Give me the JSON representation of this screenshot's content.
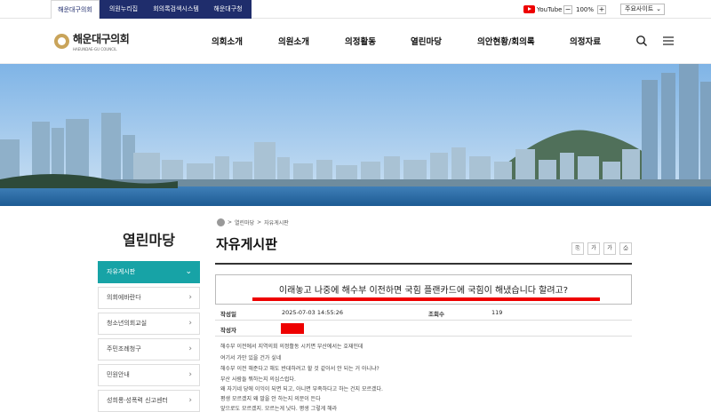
{
  "top_tabs": [
    "해운대구의회",
    "의원누리집",
    "회의록검색시스템",
    "해운대구청"
  ],
  "youtube_label": "YouTube",
  "zoom": {
    "minus": "−",
    "value": "100%",
    "plus": "+"
  },
  "sitemap_select": "주요사이트",
  "logo": {
    "main": "해운대구의회",
    "sub": "HAEUNDAE-GU COUNCIL"
  },
  "gnb": [
    "의회소개",
    "의원소개",
    "의정활동",
    "열린마당",
    "의안현황/회의록",
    "의정자료"
  ],
  "lnb": {
    "title": "열린마당",
    "items": [
      {
        "label": "자유게시판",
        "active": true,
        "arrow": "⌄"
      },
      {
        "label": "의회에바란다",
        "active": false,
        "arrow": "›"
      },
      {
        "label": "청소년의회교실",
        "active": false,
        "arrow": "›"
      },
      {
        "label": "주민조례청구",
        "active": false,
        "arrow": "›"
      },
      {
        "label": "민원안내",
        "active": false,
        "arrow": "›"
      },
      {
        "label": "성희롱·성폭력 신고센터",
        "active": false,
        "arrow": "›"
      }
    ]
  },
  "breadcrumb": {
    "sep": ">",
    "level1": "열린마당",
    "level2": "자유게시판"
  },
  "page_title": "자유게시판",
  "tools": [
    "⎘",
    "가",
    "가",
    "⎙"
  ],
  "post": {
    "title": "이래놓고 나중에 해수부 이전하면 국힘 플랜카드에 국힘이 해냈습니다 할려고?",
    "date_label": "작성일",
    "date_value": "2025-07-03 14:55:26",
    "views_label": "조회수",
    "views_value": "119",
    "author_label": "작성자",
    "body": [
      "해수부 이전에서 지역의회 의정활동 시키면 부산에서는 호재인데",
      "여기서 가만 있을 건가 싶네",
      "해수부 이전 해준다고 해도 반대하려고 할 것 같아서 안 되는 거 아니냐?",
      "부산 사람들 뭐하는지 의심스럽다.",
      "왜 자기네 당에 이익이 되면 되고, 아니면 부족하다고 하는 건지 모르겠다.",
      "평생 모르겠지 왜 말을 안 하는지 의문이 든다",
      "앞으로도 모르겠지. 모르는게 낫다. 평생 그렇게 해라"
    ]
  }
}
